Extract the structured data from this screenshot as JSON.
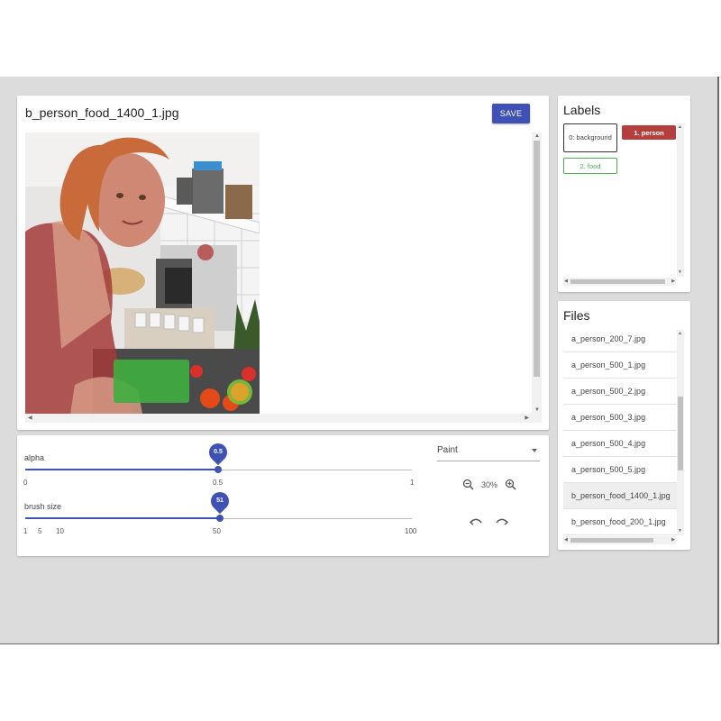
{
  "editor": {
    "filename": "b_person_food_1400_1.jpg",
    "save_label": "SAVE"
  },
  "controls": {
    "alpha": {
      "label": "alpha",
      "value": "0.5",
      "fraction": 0.5,
      "ticks": [
        "0",
        "0.5",
        "1"
      ]
    },
    "brush": {
      "label": "brush size",
      "value": "51",
      "fraction": 0.51,
      "ticks": [
        "1",
        "5",
        "10",
        "50",
        "100"
      ]
    },
    "mode": "Paint",
    "zoom": "30%"
  },
  "labels": {
    "title": "Labels",
    "items": [
      {
        "text": "0: background",
        "color": "#333333"
      },
      {
        "text": "1. person",
        "color": "#b3403f"
      },
      {
        "text": "2. food",
        "color": "#4caf50"
      }
    ]
  },
  "files": {
    "title": "Files",
    "items": [
      "a_person_200_7.jpg",
      "a_person_500_1.jpg",
      "a_person_500_2.jpg",
      "a_person_500_3.jpg",
      "a_person_500_4.jpg",
      "a_person_500_5.jpg",
      "b_person_food_1400_1.jpg",
      "b_person_food_200_1.jpg"
    ],
    "selected": "b_person_food_1400_1.jpg"
  },
  "colors": {
    "accent": "#3f51b5",
    "person": "#b3403f",
    "food": "#4caf50"
  }
}
